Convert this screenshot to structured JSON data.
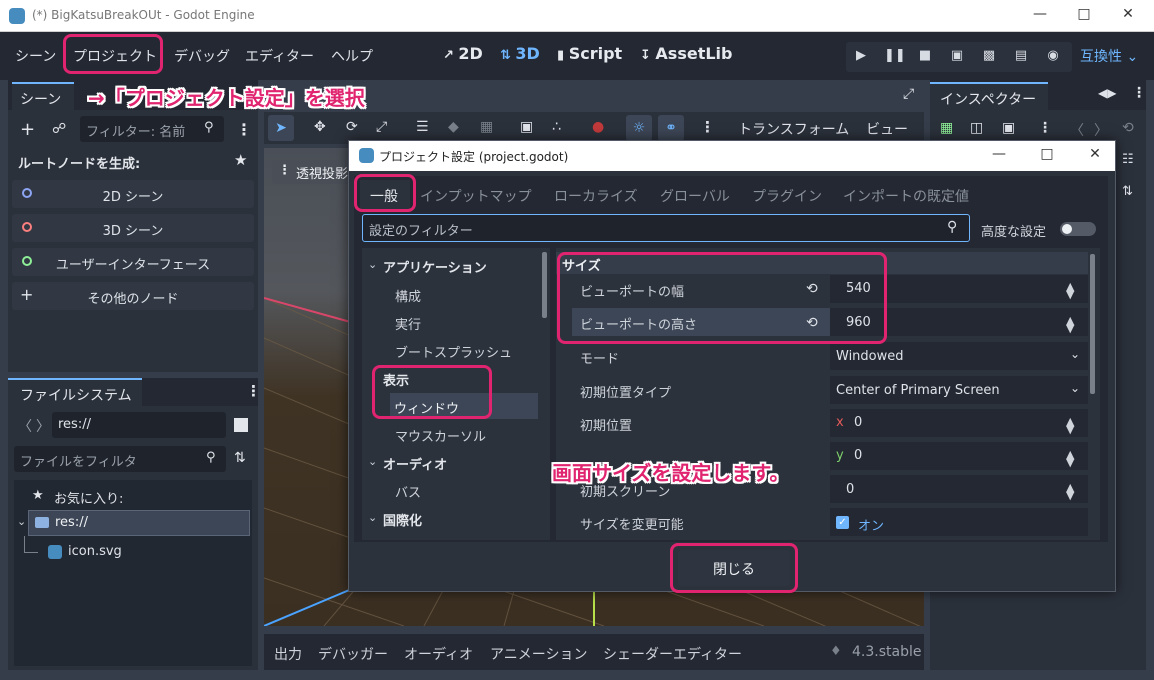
{
  "window": {
    "title": "(*) BigKatsuBreakOUt - Godot Engine"
  },
  "menu": {
    "scene": "シーン",
    "project": "プロジェクト",
    "debug": "デバッグ",
    "editor": "エディター",
    "help": "ヘルプ",
    "compat": "互換性"
  },
  "modes": {
    "m2d": "2D",
    "m3d": "3D",
    "script": "Script",
    "assetlib": "AssetLib"
  },
  "scene_panel": {
    "tab": "シーン",
    "filter_placeholder": "フィルター: 名前",
    "create_root": "ルートノードを生成:",
    "items": [
      "2D シーン",
      "3D シーン",
      "ユーザーインターフェース",
      "その他のノード"
    ]
  },
  "filesystem": {
    "tab": "ファイルシステム",
    "path": "res://",
    "filter_placeholder": "ファイルをフィルタ",
    "favorites": "お気に入り:",
    "root": "res://",
    "file": "icon.svg"
  },
  "viewport": {
    "transform": "トランスフォーム",
    "view": "ビュー",
    "perspective": "透視投影"
  },
  "inspector": {
    "tab": "インスペクター"
  },
  "bottom": {
    "tabs": [
      "出力",
      "デバッガー",
      "オーディオ",
      "アニメーション",
      "シェーダーエディター"
    ],
    "version": "4.3.stable"
  },
  "dialog": {
    "title": "プロジェクト設定 (project.godot)",
    "tabs": [
      "一般",
      "インプットマップ",
      "ローカライズ",
      "グローバル",
      "プラグイン",
      "インポートの既定値"
    ],
    "filter_placeholder": "設定のフィルター",
    "advanced": "高度な設定",
    "tree": {
      "application": "アプリケーション",
      "config": "構成",
      "run": "実行",
      "boot": "ブートスプラッシュ",
      "display": "表示",
      "window": "ウィンドウ",
      "mouse": "マウスカーソル",
      "audio": "オーディオ",
      "bus": "バス",
      "intl": "国際化"
    },
    "section": "サイズ",
    "props": {
      "vw_label": "ビューポートの幅",
      "vw_value": "540",
      "vh_label": "ビューポートの高さ",
      "vh_value": "960",
      "mode_label": "モード",
      "mode_value": "Windowed",
      "ipt_label": "初期位置タイプ",
      "ipt_value": "Center of Primary Screen",
      "ip_label": "初期位置",
      "ip_x_axis": "x",
      "ip_x": "0",
      "ip_y_axis": "y",
      "ip_y": "0",
      "screen_label": "初期スクリーン",
      "screen_value": "0",
      "resizable_label": "サイズを変更可能",
      "resizable_value": "オン"
    },
    "close": "閉じる"
  },
  "annotations": {
    "arrow": "→「プロジェクト設定」を選択",
    "size": "画面サイズを設定します。"
  },
  "colors": {
    "accent": "#4ea4ff",
    "annotation": "#e0246f",
    "dot2d": "#8da5f3",
    "dot3d": "#fc7f7f",
    "dotui": "#8eef97"
  }
}
